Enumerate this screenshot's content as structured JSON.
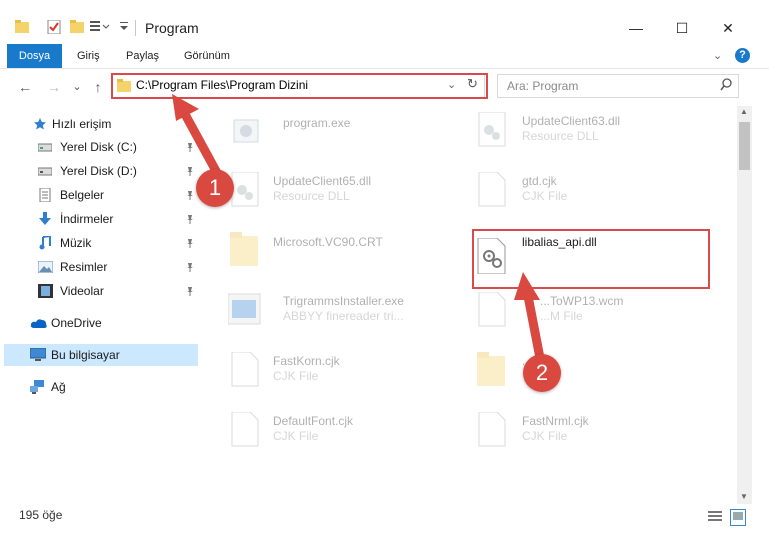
{
  "window": {
    "title": "Program",
    "minimize": "—",
    "maximize": "☐",
    "close": "✕"
  },
  "ribbon": {
    "tabs": [
      "Dosya",
      "Giriş",
      "Paylaş",
      "Görünüm"
    ],
    "help": "?",
    "expand": "⌄"
  },
  "nav": {
    "back": "←",
    "forward": "→",
    "recent": "⌄",
    "up": "↑"
  },
  "address": {
    "path": "C:\\Program Files\\Program Dizini",
    "dropdown": "⌄",
    "refresh": "↻"
  },
  "search": {
    "placeholder": "Ara: Program",
    "icon": "search-icon"
  },
  "sidebar": {
    "items": [
      {
        "label": "Hızlı erişim",
        "icon": "star-icon",
        "pinned": false
      },
      {
        "label": "Yerel Disk (C:)",
        "icon": "drive-icon",
        "pinned": true
      },
      {
        "label": "Yerel Disk (D:)",
        "icon": "drive-icon",
        "pinned": true
      },
      {
        "label": "Belgeler",
        "icon": "documents-icon",
        "pinned": true
      },
      {
        "label": "İndirmeler",
        "icon": "download-icon",
        "pinned": true
      },
      {
        "label": "Müzik",
        "icon": "music-icon",
        "pinned": true
      },
      {
        "label": "Resimler",
        "icon": "pictures-icon",
        "pinned": true
      },
      {
        "label": "Videolar",
        "icon": "videos-icon",
        "pinned": true
      },
      {
        "label": "OneDrive",
        "icon": "cloud-icon",
        "pinned": false
      },
      {
        "label": "Bu bilgisayar",
        "icon": "computer-icon",
        "pinned": false
      },
      {
        "label": "Ağ",
        "icon": "network-icon",
        "pinned": false
      }
    ],
    "pin_glyph": "📌"
  },
  "files": [
    {
      "name": "program.exe",
      "type": "",
      "icon": "exe-icon"
    },
    {
      "name": "UpdateClient63.dll",
      "type": "Resource DLL",
      "icon": "dll-icon"
    },
    {
      "name": "UpdateClient65.dll",
      "type": "Resource DLL",
      "icon": "dll-icon"
    },
    {
      "name": "gtd.cjk",
      "type": "CJK File",
      "icon": "file-icon"
    },
    {
      "name": "Microsoft.VC90.CRT",
      "type": "",
      "icon": "folder-icon"
    },
    {
      "name": "libalias_api.dll",
      "type": "",
      "icon": "dll-icon"
    },
    {
      "name": "TrigrammsInstaller.exe",
      "type": "ABBYY finereader tri...",
      "icon": "installer-icon"
    },
    {
      "name": "...ToWP13.wcm",
      "type": "...M File",
      "icon": "file-icon"
    },
    {
      "name": "FastKorn.cjk",
      "type": "CJK File",
      "icon": "file-icon"
    },
    {
      "name": "...",
      "type": "",
      "icon": "folder-icon"
    },
    {
      "name": "DefaultFont.cjk",
      "type": "CJK File",
      "icon": "file-icon"
    },
    {
      "name": "FastNrml.cjk",
      "type": "CJK File",
      "icon": "file-icon"
    }
  ],
  "status": {
    "count": "195 öğe"
  },
  "annotations": {
    "step1": "1",
    "step2": "2",
    "color": "#d9493f"
  }
}
